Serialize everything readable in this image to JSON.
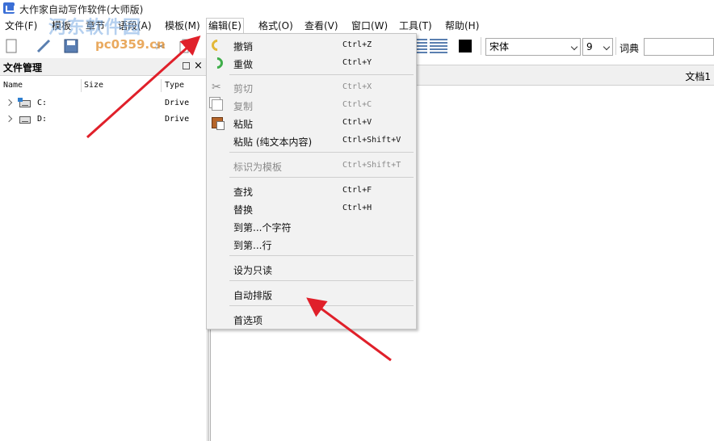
{
  "window": {
    "title": "大作家自动写作软件(大师版)"
  },
  "watermark": {
    "text": "河东软件园",
    "url": "pc0359.cn"
  },
  "menubar": {
    "items": [
      {
        "label": "文件(F)"
      },
      {
        "label": "模板"
      },
      {
        "label": "章节"
      },
      {
        "label": "语段(A)"
      },
      {
        "label": "模板(M)"
      },
      {
        "label": "编辑(E)"
      },
      {
        "label": "格式(O)"
      },
      {
        "label": "查看(V)"
      },
      {
        "label": "窗口(W)"
      },
      {
        "label": "工具(T)"
      },
      {
        "label": "帮助(H)"
      }
    ]
  },
  "toolbar": {
    "font_family": "宋体",
    "font_size": "9",
    "dict_label": "词典",
    "dict_value": ""
  },
  "file_panel": {
    "title": "文件管理",
    "columns": {
      "name": "Name",
      "size": "Size",
      "type": "Type"
    },
    "drives": [
      {
        "name": "C:",
        "type": "Drive"
      },
      {
        "name": "D:",
        "type": "Drive"
      }
    ]
  },
  "document": {
    "tab_label": "文档1"
  },
  "edit_menu": {
    "undo": {
      "label": "撤销",
      "shortcut": "Ctrl+Z"
    },
    "redo": {
      "label": "重做",
      "shortcut": "Ctrl+Y"
    },
    "cut": {
      "label": "剪切",
      "shortcut": "Ctrl+X"
    },
    "copy": {
      "label": "复制",
      "shortcut": "Ctrl+C"
    },
    "paste": {
      "label": "粘贴",
      "shortcut": "Ctrl+V"
    },
    "paste_plain": {
      "label": "粘贴 (纯文本内容)",
      "shortcut": "Ctrl+Shift+V"
    },
    "mark_template": {
      "label": "标识为模板",
      "shortcut": "Ctrl+Shift+T"
    },
    "find": {
      "label": "查找",
      "shortcut": "Ctrl+F"
    },
    "replace": {
      "label": "替换",
      "shortcut": "Ctrl+H"
    },
    "goto_char": {
      "label": "到第...个字符"
    },
    "goto_line": {
      "label": "到第...行"
    },
    "read_only": {
      "label": "设为只读"
    },
    "auto_format": {
      "label": "自动排版"
    },
    "preferences": {
      "label": "首选项"
    }
  },
  "annotation_color": "#e0202a"
}
